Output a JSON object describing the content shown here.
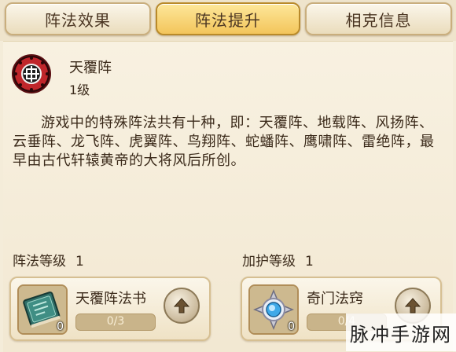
{
  "tabs": [
    {
      "label": "阵法效果",
      "active": false
    },
    {
      "label": "阵法提升",
      "active": true
    },
    {
      "label": "相克信息",
      "active": false
    }
  ],
  "formation": {
    "name": "天覆阵",
    "level": "1级",
    "emblem_icon": "formation-emblem-icon",
    "description": "游戏中的特殊阵法共有十种，即：天覆阵、地载阵、风扬阵、云垂阵、龙飞阵、虎翼阵、鸟翔阵、蛇蟠阵、鹰啸阵、雷绝阵，最早由古代轩辕黄帝的大将风后所创。"
  },
  "sections": {
    "formation_level": {
      "label": "阵法等级",
      "value": "1"
    },
    "protection_level": {
      "label": "加护等级",
      "value": "1"
    }
  },
  "items": {
    "left": {
      "name": "天覆阵法书",
      "count": "0",
      "progress_text": "0/3",
      "progress": 0,
      "icon": "book-icon"
    },
    "right": {
      "name": "奇门法窍",
      "count": "0",
      "progress_text": "0/4",
      "progress": 0,
      "icon": "gem-icon"
    }
  },
  "watermark": "脉冲手游网",
  "colors": {
    "active_tab": "#f3c55b",
    "panel": "#f4ecd9",
    "emblem_red": "#c0262b"
  }
}
